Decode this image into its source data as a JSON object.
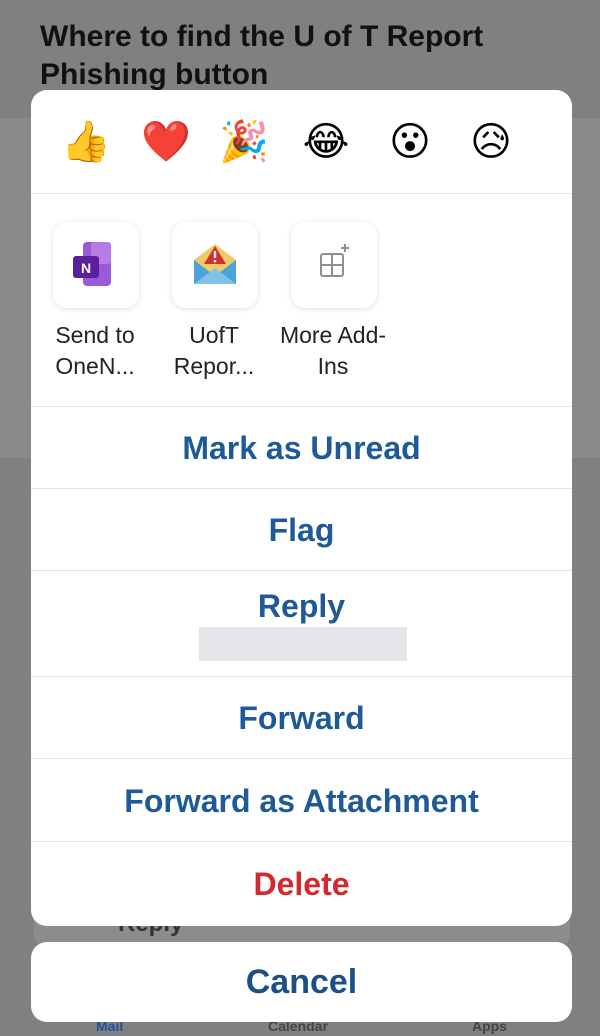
{
  "background": {
    "title": "Where to find the U of T Report Phishing button",
    "reply_label": "Reply",
    "tabs": [
      "Mail",
      "Calendar",
      "Apps"
    ]
  },
  "reactions": [
    {
      "name": "thumbs-up-icon",
      "glyph": "👍"
    },
    {
      "name": "heart-icon",
      "glyph": "❤️"
    },
    {
      "name": "party-popper-icon",
      "glyph": "🎉"
    },
    {
      "name": "laughing-icon",
      "glyph": "😂"
    },
    {
      "name": "surprised-icon",
      "glyph": "😮"
    },
    {
      "name": "sad-icon",
      "glyph": "😥"
    }
  ],
  "addins": [
    {
      "name": "onenote-icon",
      "label": "Send to OneN..."
    },
    {
      "name": "report-phishing-icon",
      "label": "UofT Repor..."
    },
    {
      "name": "more-addins-icon",
      "label": "More Add-Ins"
    }
  ],
  "menu": {
    "mark_unread": "Mark as Unread",
    "flag": "Flag",
    "reply": "Reply",
    "forward": "Forward",
    "forward_attachment": "Forward as Attachment",
    "delete": "Delete"
  },
  "cancel": "Cancel",
  "colors": {
    "action": "#1e5a97",
    "destructive": "#d3282e",
    "onenote": "#7a3cc4",
    "warning": "#d62d2d"
  }
}
